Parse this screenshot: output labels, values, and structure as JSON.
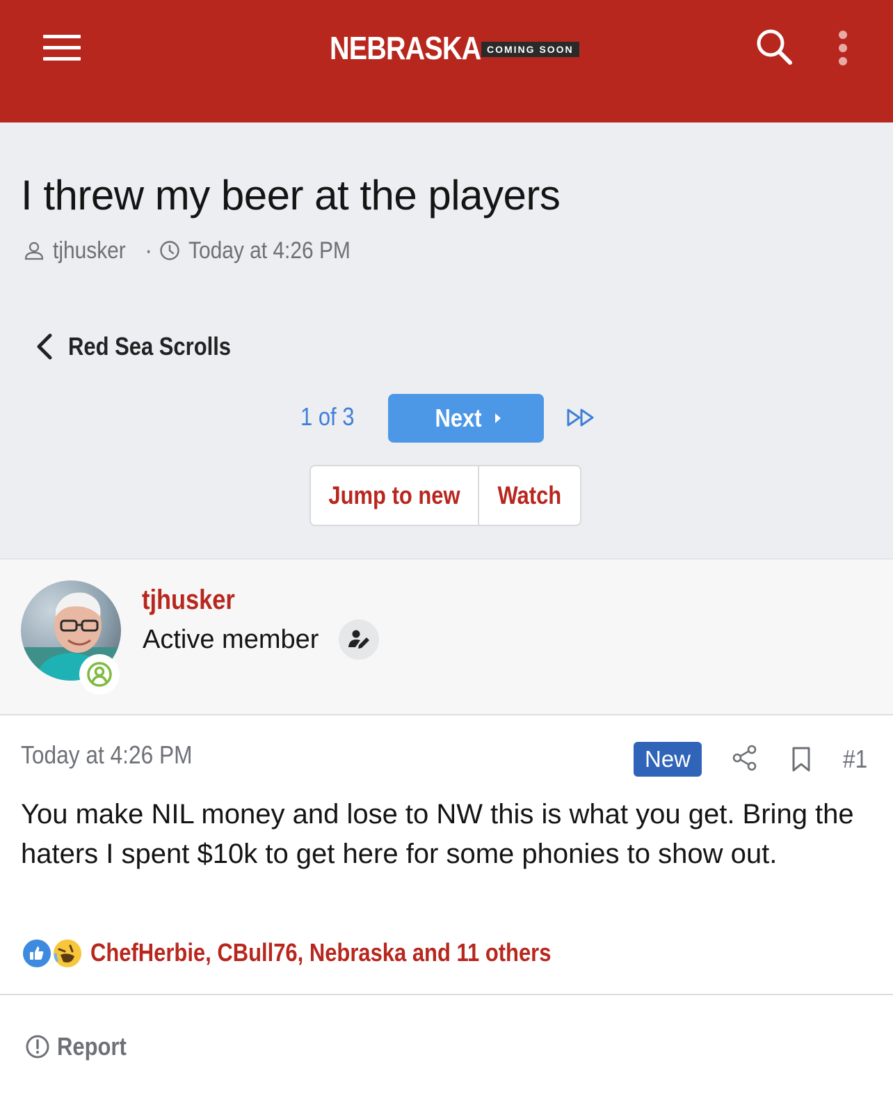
{
  "header": {
    "logo_text": "NEBRASKA",
    "logo_tag": "COMING SOON",
    "menu_icon": "hamburger-menu-icon",
    "search_icon": "search-icon",
    "more_icon": "more-vertical-icon",
    "brand_color": "#b8271e"
  },
  "thread": {
    "title": "I threw my beer at the players",
    "author": "tjhusker",
    "separator": "·",
    "posted": "Today at 4:26 PM",
    "breadcrumb": "Red Sea Scrolls"
  },
  "pagination": {
    "info": "1 of 3",
    "next_label": "Next",
    "last_icon": "fast-forward-icon"
  },
  "actions": {
    "jump_label": "Jump to new",
    "watch_label": "Watch"
  },
  "user": {
    "name": "tjhusker",
    "title": "Active member",
    "status_icon": "online-user-icon",
    "edit_icon": "user-edit-icon"
  },
  "post": {
    "time": "Today at 4:26 PM",
    "badge": "New",
    "number": "#1",
    "body": "You make NIL money and lose to NW this is what you get. Bring the haters I spent $10k to get here for some phonies to show out.",
    "reactions": {
      "icons": [
        "like-icon",
        "haha-icon"
      ],
      "users_text": "ChefHerbie, CBull76, Nebraska and 11 others"
    },
    "report_label": "Report"
  }
}
